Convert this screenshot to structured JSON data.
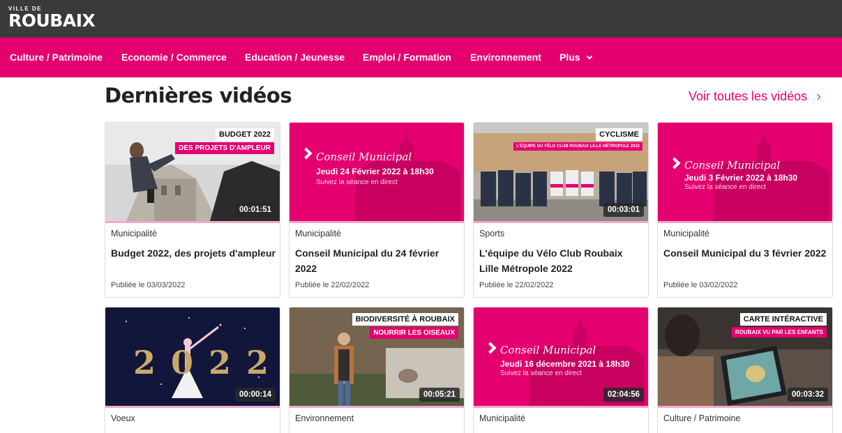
{
  "logo": {
    "small": "VILLE DE",
    "main": "ROUBAIX"
  },
  "nav": [
    {
      "label": "Culture / Patrimoine"
    },
    {
      "label": "Economie / Commerce"
    },
    {
      "label": "Education / Jeunesse"
    },
    {
      "label": "Emploi / Formation"
    },
    {
      "label": "Environnement"
    },
    {
      "label": "Plus"
    }
  ],
  "section": {
    "title": "Dernières vidéos",
    "see_all": "Voir toutes les vidéos"
  },
  "videos": [
    {
      "category": "Municipalité",
      "title": "Budget 2022, des projets d'ampleur",
      "date": "Publiée le 03/03/2022",
      "duration": "00:01:51",
      "tag1": "BUDGET 2022",
      "tag2": "DES PROJETS D'AMPLEUR"
    },
    {
      "category": "Municipalité",
      "title": "Conseil Municipal du 24 février 2022",
      "date": "Publiée le 22/02/2022",
      "duration": "",
      "cm_title": "Conseil Municipal",
      "cm_date": "Jeudi 24 Février 2022 à 18h30",
      "cm_sub": "Suivez la séance en direct"
    },
    {
      "category": "Sports",
      "title": "L'équipe du Vélo Club Roubaix Lille Métropole 2022",
      "date": "Publiée le 22/02/2022",
      "duration": "00:03:01",
      "tag1": "CYCLISME",
      "tag2": "L'ÉQUIPE DU VÉLO CLUB ROUBAIX LILLE MÉTROPOLE 2022"
    },
    {
      "category": "Municipalité",
      "title": "Conseil Municipal du 3 février 2022",
      "date": "Publiée le 03/02/2022",
      "duration": "",
      "cm_title": "Conseil Municipal",
      "cm_date": "Jeudi 3 Février 2022 à 18h30",
      "cm_sub": "Suivez la séance en direct"
    },
    {
      "category": "Voeux",
      "duration": "00:00:14",
      "art_text": "2022"
    },
    {
      "category": "Environnement",
      "duration": "00:05:21",
      "tag1": "BIODIVERSITÉ À ROUBAIX",
      "tag2": "NOURRIR LES OISEAUX"
    },
    {
      "category": "Municipalité",
      "duration": "02:04:56",
      "cm_title": "Conseil Municipal",
      "cm_date": "Jeudi 16 décembre 2021 à 18h30",
      "cm_sub": "Suivez la séance en direct"
    },
    {
      "category": "Culture / Patrimoine",
      "duration": "00:03:32",
      "tag1": "CARTE INTÉRACTIVE",
      "tag2": "ROUBAIX VU PAR LES ENFANTS"
    }
  ],
  "colors": {
    "brand_pink": "#e5006f",
    "topbar": "#3b3a3a"
  }
}
